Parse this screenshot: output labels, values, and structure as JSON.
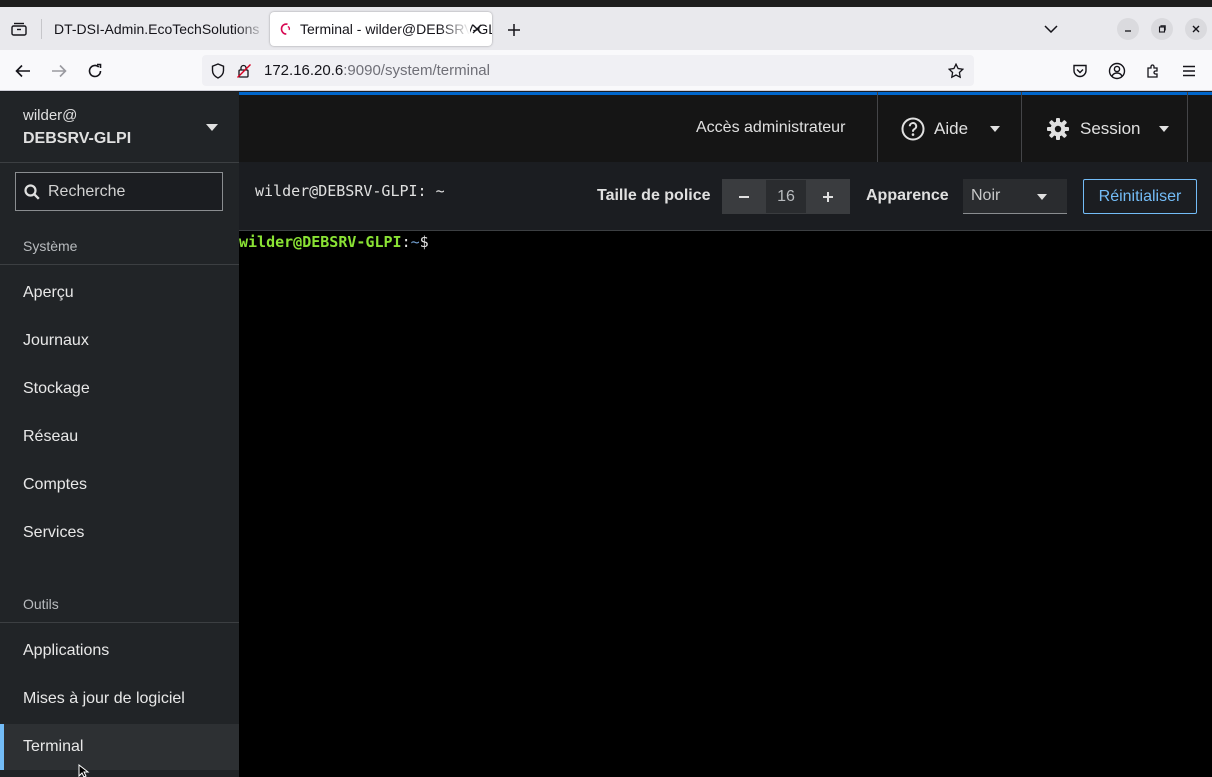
{
  "browser": {
    "tabs": [
      {
        "label": "DT-DSI-Admin.EcoTechSolutions",
        "active": false
      },
      {
        "label": "Terminal - wilder@DEBSRV-GLPI",
        "active": true
      }
    ],
    "url": {
      "host": "172.16.20.6",
      "rest": ":9090/system/terminal"
    }
  },
  "sidebar": {
    "host_user": "wilder@",
    "host_name": "DEBSRV-GLPI",
    "search_placeholder": "Recherche",
    "sections": [
      {
        "label": "Système",
        "items": [
          "Aperçu",
          "Journaux",
          "Stockage",
          "Réseau",
          "Comptes",
          "Services"
        ]
      },
      {
        "label": "Outils",
        "items": [
          "Applications",
          "Mises à jour de logiciel",
          "Terminal"
        ]
      }
    ],
    "active_item": "Terminal"
  },
  "topbar": {
    "admin_access": "Accès administrateur",
    "help": "Aide",
    "session": "Session",
    "accent_color": "#0066cc"
  },
  "toolbar": {
    "title": "wilder@DEBSRV-GLPI: ~",
    "font_size_label": "Taille de police",
    "font_size_value": "16",
    "appearance_label": "Apparence",
    "appearance_value": "Noir",
    "reset_label": "Réinitialiser"
  },
  "terminal": {
    "prompt_user": "wilder@DEBSRV-GLPI",
    "prompt_colon": ":",
    "prompt_path": "~",
    "prompt_symbol": "$",
    "colors": {
      "user": "#8ae234",
      "path": "#729fcf"
    }
  }
}
